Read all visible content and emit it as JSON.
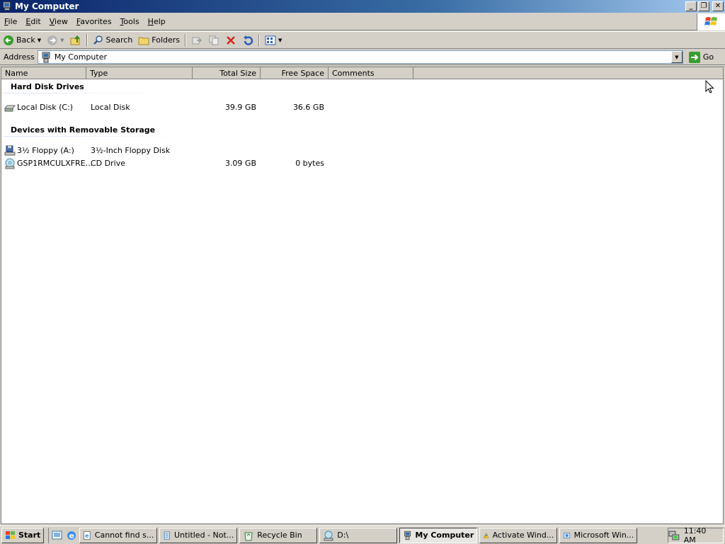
{
  "window": {
    "title": "My Computer",
    "controls": {
      "minimize": "_",
      "restore": "❐",
      "close": "✕"
    }
  },
  "menu": [
    {
      "label": "File",
      "accel": "F",
      "rest": "ile"
    },
    {
      "label": "Edit",
      "accel": "E",
      "rest": "dit"
    },
    {
      "label": "View",
      "accel": "V",
      "rest": "iew"
    },
    {
      "label": "Favorites",
      "accel": "F",
      "rest": "avorites"
    },
    {
      "label": "Tools",
      "accel": "T",
      "rest": "ools"
    },
    {
      "label": "Help",
      "accel": "H",
      "rest": "elp"
    }
  ],
  "toolbar": {
    "back_label": "Back",
    "search_label": "Search",
    "folders_label": "Folders"
  },
  "address": {
    "label": "Address",
    "value": "My Computer",
    "go_label": "Go"
  },
  "columns": {
    "name": "Name",
    "type": "Type",
    "total_size": "Total Size",
    "free_space": "Free Space",
    "comments": "Comments"
  },
  "groups": {
    "hard_disks": {
      "title": "Hard Disk Drives",
      "items": [
        {
          "name": "Local Disk (C:)",
          "type": "Local Disk",
          "total": "39.9 GB",
          "free": "36.6 GB",
          "icon": "hard-disk-icon"
        }
      ]
    },
    "removable": {
      "title": "Devices with Removable Storage",
      "items": [
        {
          "name": "3½ Floppy (A:)",
          "type": "3½-Inch Floppy Disk",
          "total": "",
          "free": "",
          "icon": "floppy-drive-icon"
        },
        {
          "name": "GSP1RMCULXFRE...",
          "type": "CD Drive",
          "total": "3.09 GB",
          "free": "0 bytes",
          "icon": "cd-drive-icon"
        }
      ]
    }
  },
  "taskbar": {
    "start_label": "Start",
    "tasks": [
      {
        "label": "Cannot find s...",
        "icon": "ie-page-icon",
        "active": false
      },
      {
        "label": "Untitled - Not...",
        "icon": "notepad-icon",
        "active": false
      },
      {
        "label": "Recycle Bin",
        "icon": "recycle-bin-icon",
        "active": false
      },
      {
        "label": "D:\\",
        "icon": "drive-icon",
        "active": false
      },
      {
        "label": "My Computer",
        "icon": "my-computer-icon",
        "active": true
      },
      {
        "label": "Activate Wind...",
        "icon": "activate-icon",
        "active": false
      },
      {
        "label": "Microsoft Win...",
        "icon": "windows-installer-icon",
        "active": false
      }
    ],
    "clock": "11:40 AM"
  },
  "colors": {
    "title_start": "#0a246a",
    "title_end": "#a6caf0",
    "chrome": "#d4d0c8",
    "go_green": "#3b9c2f"
  }
}
